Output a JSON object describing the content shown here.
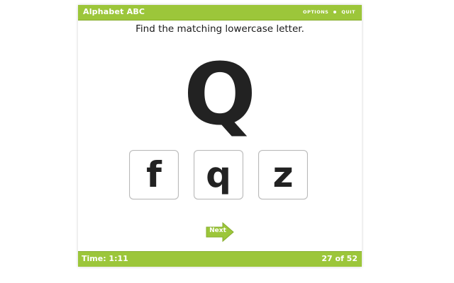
{
  "colors": {
    "bar_green": "#9cc63a",
    "text_dark": "#222222",
    "white": "#ffffff"
  },
  "header": {
    "title": "Alphabet ABC",
    "options_label": "OPTIONS",
    "quit_label": "QUIT"
  },
  "game": {
    "prompt": "Find the matching lowercase letter.",
    "target_letter": "Q",
    "choices": [
      "f",
      "q",
      "z"
    ],
    "next_label": "Next",
    "next_icon": "arrow-right-icon"
  },
  "footer": {
    "time": "Time: 1:11",
    "progress": "27 of 52"
  }
}
